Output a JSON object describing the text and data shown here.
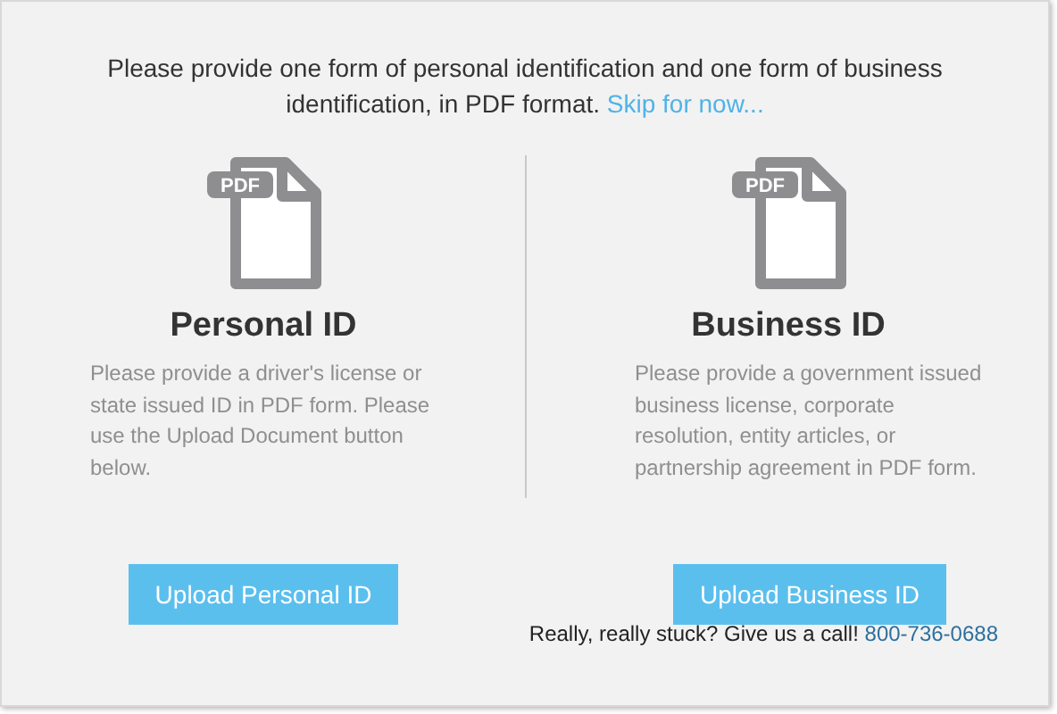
{
  "intro": {
    "text": "Please provide one form of personal identification and one form of business identification, in PDF format.",
    "link": "Skip for now..."
  },
  "columns": [
    {
      "badge": "PDF",
      "title": "Personal ID",
      "description": "Please provide a driver's license or state issued ID in PDF form. Please use the Upload Document button below.",
      "button": "Upload Personal ID"
    },
    {
      "badge": "PDF",
      "title": "Business ID",
      "description": "Please provide a government issued business license, corporate resolution, entity articles, or partnership agreement in PDF form.",
      "button": "Upload Business ID"
    }
  ],
  "footer": {
    "text": "Really, really stuck? Give us a call!",
    "phone": "800-736-0688"
  }
}
